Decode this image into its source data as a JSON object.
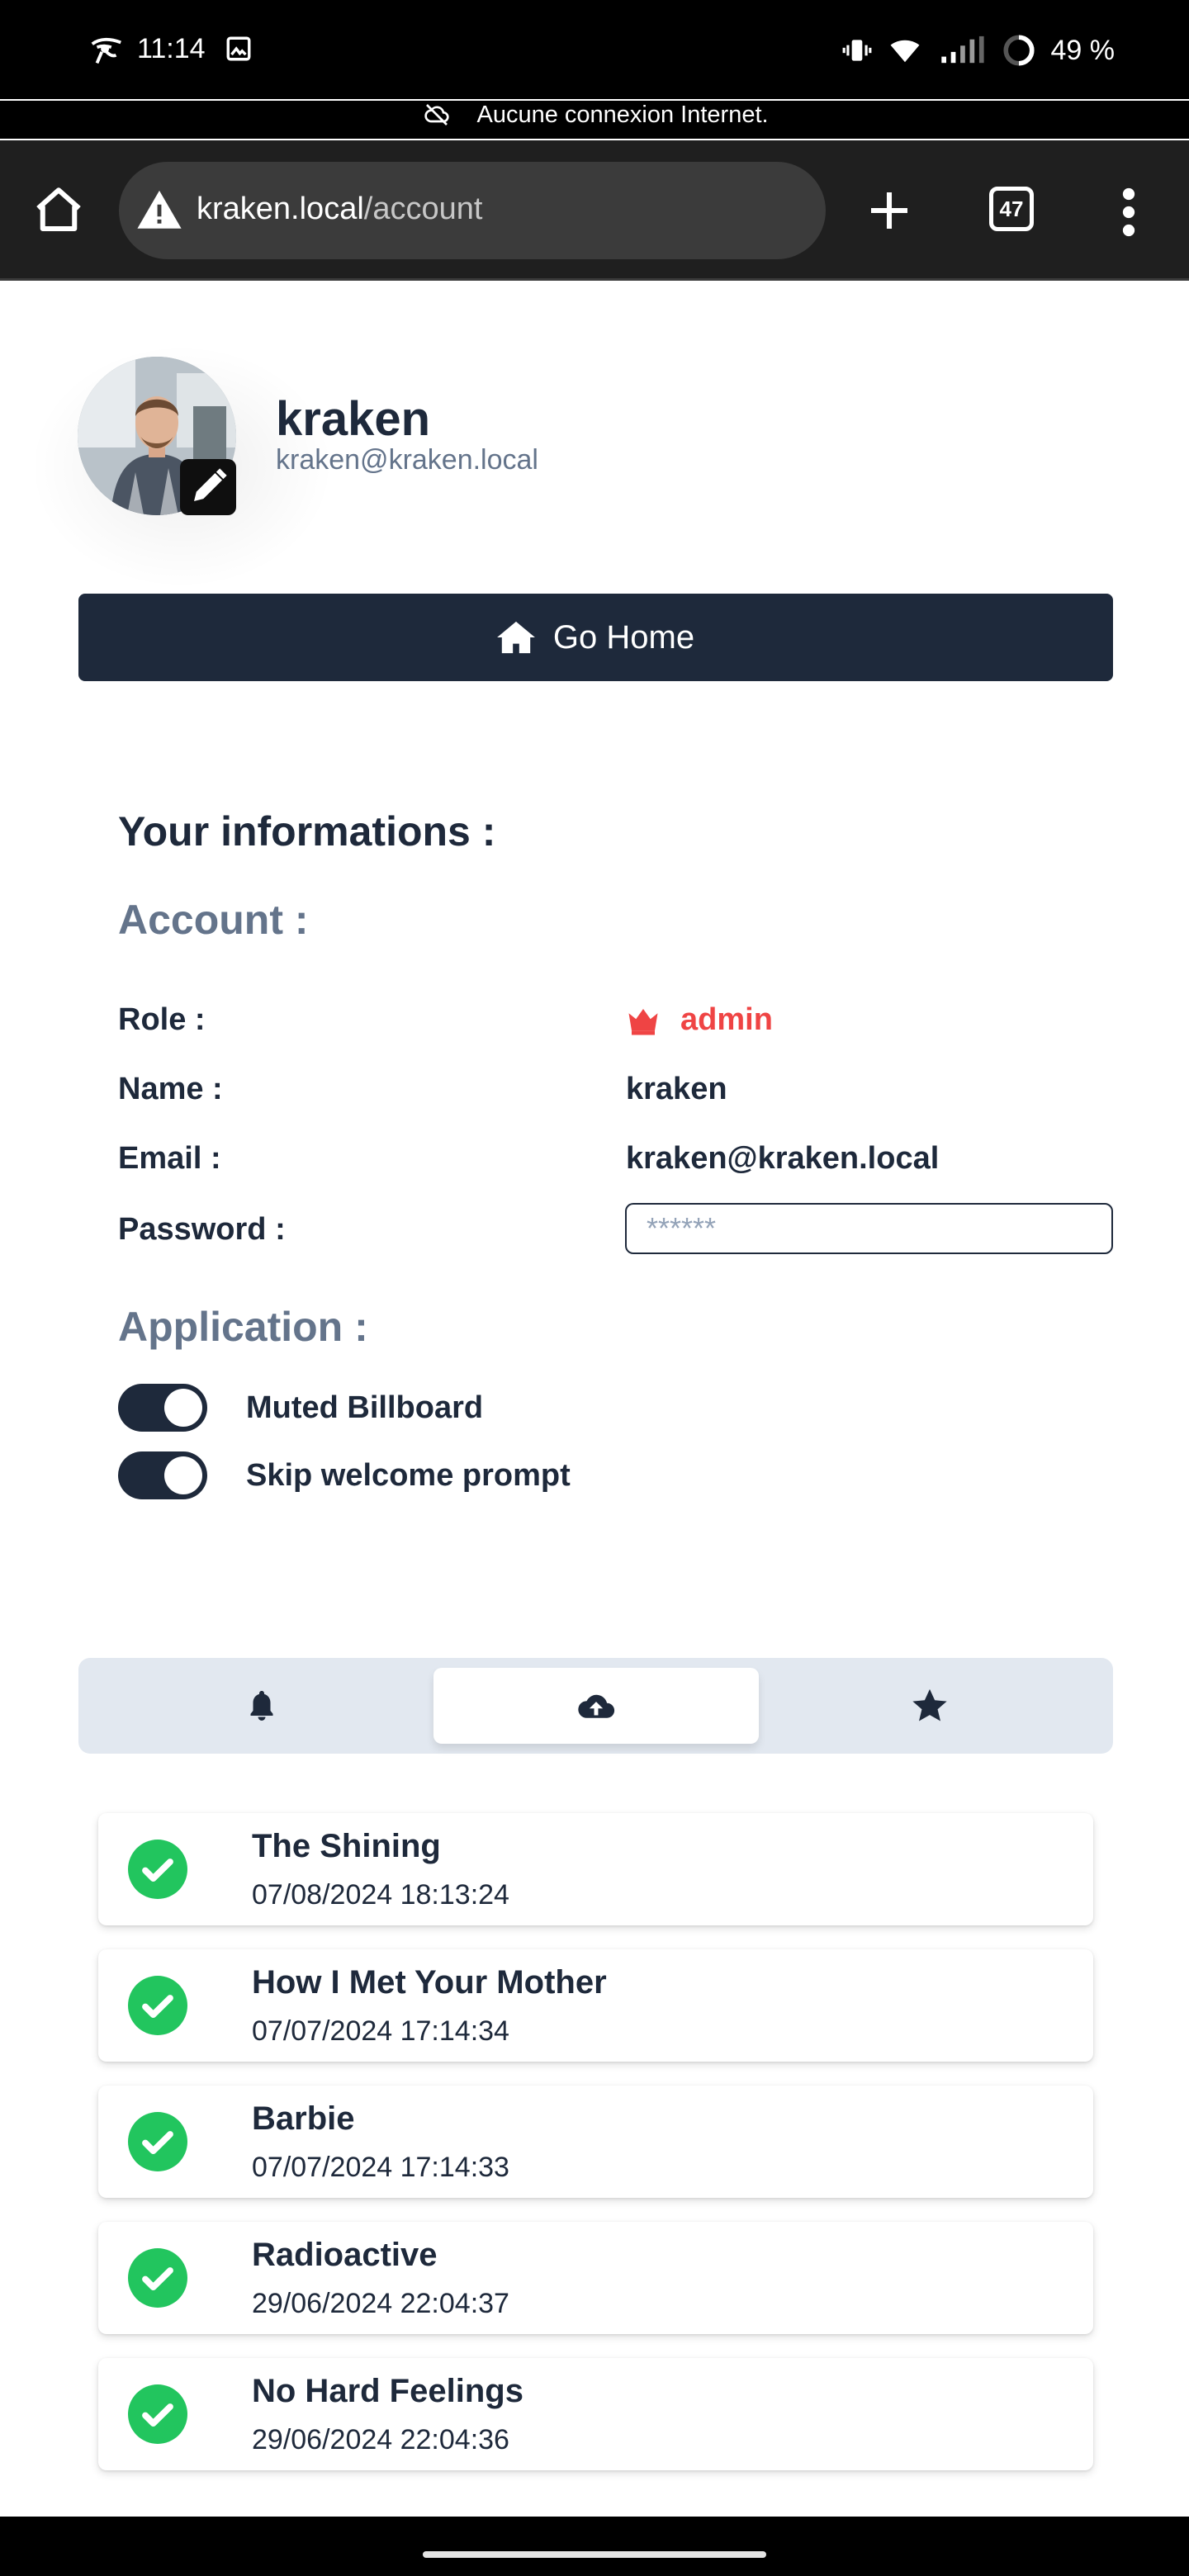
{
  "status_bar": {
    "time": "11:14",
    "battery": "49 %",
    "offline_message": "Aucune connexion Internet."
  },
  "browser": {
    "url_host": "kraken.local",
    "url_path": "/account",
    "tab_count": "47"
  },
  "profile": {
    "username": "kraken",
    "email": "kraken@kraken.local"
  },
  "go_home_label": "Go Home",
  "info": {
    "heading": "Your informations :",
    "account_heading": "Account :",
    "role_label": "Role :",
    "role_value": "admin",
    "name_label": "Name :",
    "name_value": "kraken",
    "email_label": "Email :",
    "email_value": "kraken@kraken.local",
    "password_label": "Password :",
    "password_placeholder": "******",
    "application_heading": "Application :",
    "toggles": [
      {
        "label": "Muted Billboard",
        "on": true
      },
      {
        "label": "Skip welcome prompt",
        "on": true
      }
    ]
  },
  "tabs": [
    {
      "icon": "bell-icon",
      "active": false
    },
    {
      "icon": "cloud-upload-icon",
      "active": true
    },
    {
      "icon": "star-icon",
      "active": false
    }
  ],
  "history": [
    {
      "title": "The Shining",
      "date": "07/08/2024 18:13:24"
    },
    {
      "title": "How I Met Your Mother",
      "date": "07/07/2024 17:14:34"
    },
    {
      "title": "Barbie",
      "date": "07/07/2024 17:14:33"
    },
    {
      "title": "Radioactive",
      "date": "29/06/2024 22:04:37"
    },
    {
      "title": "No Hard Feelings",
      "date": "29/06/2024 22:04:36"
    }
  ],
  "colors": {
    "primary": "#1e293b",
    "muted": "#64748b",
    "admin": "#ef4444",
    "success": "#22c55e",
    "tabbar": "#e2e8f0"
  }
}
